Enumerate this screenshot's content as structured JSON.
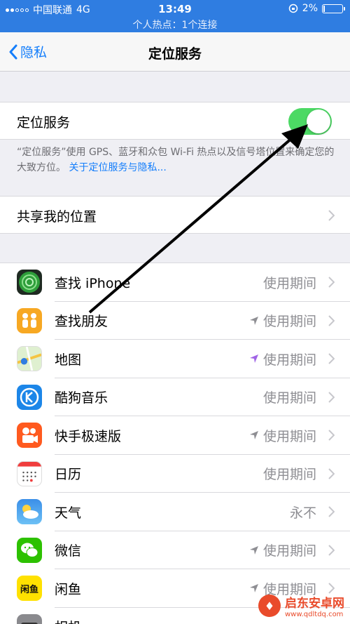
{
  "status_bar": {
    "carrier": "中国联通",
    "network": "4G",
    "time": "13:49",
    "battery": "2%",
    "hotspot": "个人热点：1个连接"
  },
  "nav": {
    "back_label": "隐私",
    "title": "定位服务"
  },
  "location_services": {
    "label": "定位服务",
    "toggle_on": true,
    "footnote": "“定位服务”使用 GPS、蓝牙和众包 Wi-Fi 热点以及信号塔位置来确定您的大致方位。",
    "footnote_link": "关于定位服务与隐私..."
  },
  "share_location": {
    "label": "共享我的位置"
  },
  "apps": [
    {
      "name": "查找 iPhone",
      "value": "使用期间",
      "icon": "find-iphone-icon",
      "arrow": ""
    },
    {
      "name": "查找朋友",
      "value": "使用期间",
      "icon": "find-friends-icon",
      "arrow": "gray"
    },
    {
      "name": "地图",
      "value": "使用期间",
      "icon": "maps-icon",
      "arrow": "purple"
    },
    {
      "name": "酷狗音乐",
      "value": "使用期间",
      "icon": "kugou-icon",
      "arrow": ""
    },
    {
      "name": "快手极速版",
      "value": "使用期间",
      "icon": "kuaishou-icon",
      "arrow": "gray"
    },
    {
      "name": "日历",
      "value": "使用期间",
      "icon": "calendar-icon",
      "arrow": ""
    },
    {
      "name": "天气",
      "value": "永不",
      "icon": "weather-icon",
      "arrow": ""
    },
    {
      "name": "微信",
      "value": "使用期间",
      "icon": "wechat-icon",
      "arrow": "gray"
    },
    {
      "name": "闲鱼",
      "value": "使用期间",
      "icon": "xianyu-icon",
      "arrow": "gray"
    },
    {
      "name": "相机",
      "value": "",
      "icon": "camera-icon",
      "arrow": ""
    }
  ],
  "watermark": {
    "brand": "启东安卓网",
    "url": "www.qdltdq.com"
  },
  "colors": {
    "accent": "#147efb",
    "status_bar": "#2f7de1",
    "toggle_on": "#4cd964",
    "secondary_text": "#8e8e93"
  }
}
